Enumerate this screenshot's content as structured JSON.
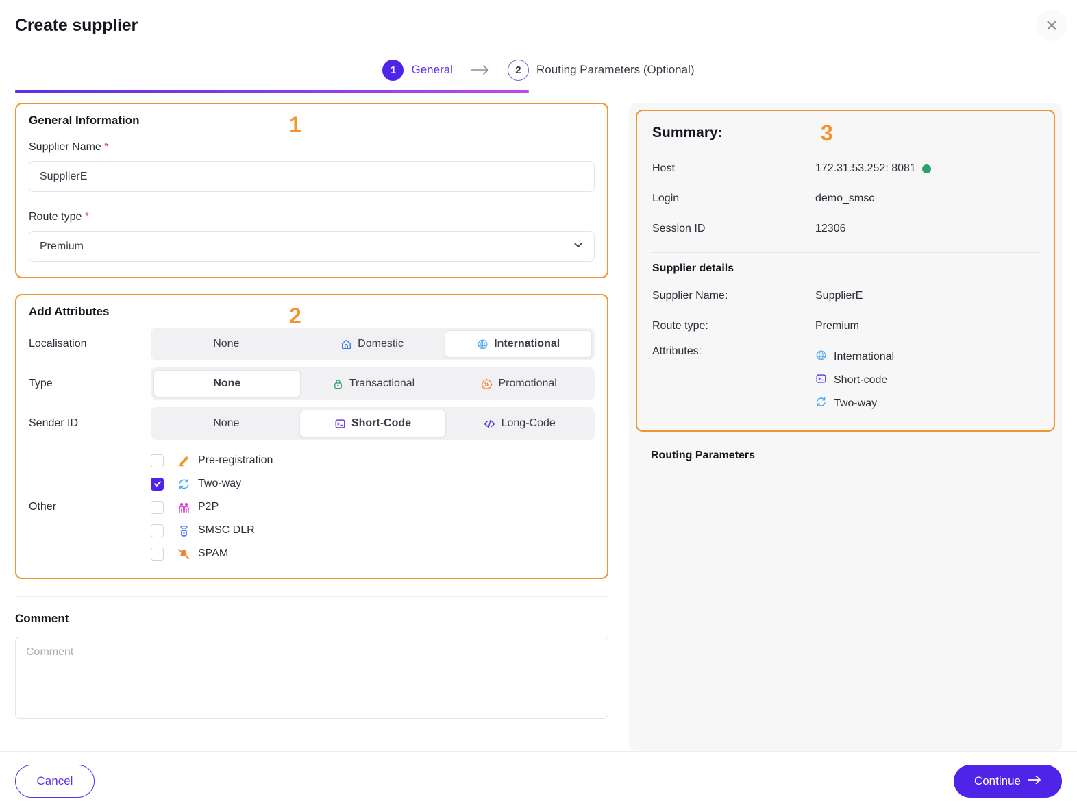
{
  "header": {
    "title": "Create supplier",
    "close_icon": "close-icon"
  },
  "stepper": {
    "steps": [
      {
        "number": "1",
        "label": "General",
        "state": "active"
      },
      {
        "number": "2",
        "label": "Routing Parameters (Optional)",
        "state": "inactive"
      }
    ],
    "arrow_icon": "arrow-right-icon",
    "progress_percent": 50,
    "gradient_from": "#5b2fe8",
    "gradient_to": "#bd4ce8"
  },
  "annotations": {
    "one": "1",
    "two": "2",
    "three": "3",
    "color": "#f0962f"
  },
  "general": {
    "heading": "General Information",
    "supplier_name": {
      "label": "Supplier Name",
      "required_mark": "*",
      "value": "SupplierE",
      "placeholder": "Supplier Name"
    },
    "route_type": {
      "label": "Route type",
      "required_mark": "*",
      "value": "Premium",
      "caret_icon": "chevron-down-icon"
    }
  },
  "attributes": {
    "heading": "Add Attributes",
    "rows": [
      {
        "label": "Localisation",
        "options": [
          {
            "label": "None",
            "icon": "none",
            "selected": false
          },
          {
            "label": "Domestic",
            "icon": "home-icon",
            "selected": false
          },
          {
            "label": "International",
            "icon": "globe-icon",
            "selected": true
          }
        ]
      },
      {
        "label": "Type",
        "options": [
          {
            "label": "None",
            "icon": "none",
            "selected": true
          },
          {
            "label": "Transactional",
            "icon": "lock-icon",
            "selected": false
          },
          {
            "label": "Promotional",
            "icon": "discount-icon",
            "selected": false
          }
        ]
      },
      {
        "label": "Sender ID",
        "options": [
          {
            "label": "None",
            "icon": "none",
            "selected": false
          },
          {
            "label": "Short-Code",
            "icon": "terminal-icon",
            "selected": true
          },
          {
            "label": "Long-Code",
            "icon": "code-icon",
            "selected": false
          }
        ]
      }
    ],
    "other": {
      "label": "Other",
      "items": [
        {
          "label": "Pre-registration",
          "icon": "pencil-icon",
          "checked": false
        },
        {
          "label": "Two-way",
          "icon": "refresh-icon",
          "checked": true
        },
        {
          "label": "P2P",
          "icon": "people-icon",
          "checked": false
        },
        {
          "label": "SMSC DLR",
          "icon": "signal-icon",
          "checked": false
        },
        {
          "label": "SPAM",
          "icon": "bell-off-icon",
          "checked": false
        }
      ]
    }
  },
  "comment": {
    "heading": "Comment",
    "value": "",
    "placeholder": "Comment"
  },
  "summary": {
    "title": "Summary:",
    "connection": [
      {
        "key": "Host",
        "value": "172.31.53.252: 8081",
        "status_dot": "#2aa36b"
      },
      {
        "key": "Login",
        "value": "demo_smsc"
      },
      {
        "key": "Session ID",
        "value": "12306"
      }
    ],
    "details_heading": "Supplier details",
    "details": [
      {
        "key": "Supplier Name:",
        "value": "SupplierE"
      },
      {
        "key": "Route type:",
        "value": "Premium"
      }
    ],
    "attributes_key": "Attributes:",
    "attributes": [
      {
        "label": "International",
        "icon": "globe-icon"
      },
      {
        "label": "Short-code",
        "icon": "terminal-icon"
      },
      {
        "label": "Two-way",
        "icon": "refresh-icon"
      }
    ],
    "routing_heading": "Routing Parameters"
  },
  "footer": {
    "cancel_label": "Cancel",
    "continue_label": "Continue",
    "continue_arrow_icon": "arrow-right-icon"
  }
}
